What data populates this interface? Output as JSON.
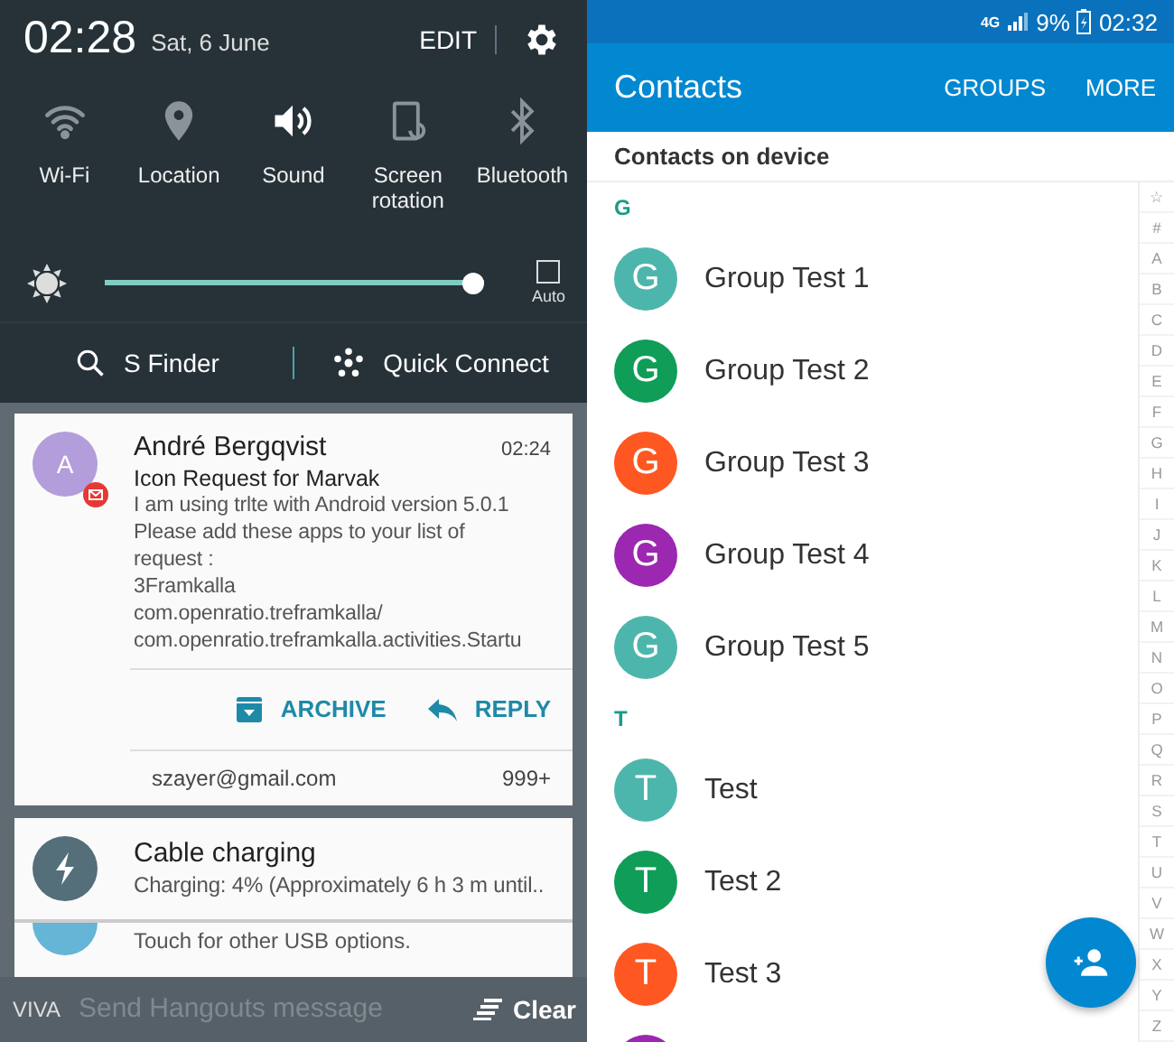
{
  "quick_panel": {
    "time": "02:28",
    "date": "Sat, 6 June",
    "edit": "EDIT",
    "toggles": [
      {
        "kind": "wifi",
        "label": "Wi-Fi",
        "on": false
      },
      {
        "kind": "location",
        "label": "Location",
        "on": false
      },
      {
        "kind": "sound",
        "label": "Sound",
        "on": true
      },
      {
        "kind": "rotation",
        "label": "Screen rotation",
        "on": false
      },
      {
        "kind": "bluetooth",
        "label": "Bluetooth",
        "on": false
      }
    ],
    "brightness": {
      "level": 1,
      "auto_label": "Auto",
      "auto_checked": false
    },
    "shortcuts": [
      {
        "kind": "search",
        "label": "S Finder"
      },
      {
        "kind": "connect",
        "label": "Quick Connect"
      }
    ]
  },
  "notifications": [
    {
      "kind": "email",
      "avatar": "A",
      "sender": "André Bergqvist",
      "time": "02:24",
      "subject": "Icon Request for Marvak",
      "body": [
        "I am using trlte with Android version 5.0.1",
        "Please add these apps to your list of",
        "request :",
        "3Framkalla",
        "com.openratio.treframkalla/",
        "com.openratio.treframkalla.activities.Startu"
      ],
      "actions": [
        {
          "kind": "archive",
          "label": "ARCHIVE"
        },
        {
          "kind": "reply",
          "label": "REPLY"
        }
      ],
      "account": "szayer@gmail.com",
      "count": "999+"
    },
    {
      "kind": "charging",
      "title": "Cable charging",
      "text": "Charging: 4% (Approximately 6 h 3 m until.."
    },
    {
      "kind": "usb",
      "text": "Touch for other USB options."
    }
  ],
  "background_app": {
    "label": "VIVA",
    "placeholder": "Send Hangouts message"
  },
  "clear_button": "Clear",
  "contacts_app": {
    "status_bar": {
      "network": "4G",
      "battery": "9%",
      "time": "02:32"
    },
    "title": "Contacts",
    "actions": [
      "GROUPS",
      "MORE"
    ],
    "subheader": "Contacts on device",
    "sections": [
      {
        "letter": "G",
        "contacts": [
          {
            "initial": "G",
            "name": "Group Test 1",
            "color": "#4db6ac"
          },
          {
            "initial": "G",
            "name": "Group Test 2",
            "color": "#0f9d58"
          },
          {
            "initial": "G",
            "name": "Group Test 3",
            "color": "#ff5722"
          },
          {
            "initial": "G",
            "name": "Group Test 4",
            "color": "#9c27b0"
          },
          {
            "initial": "G",
            "name": "Group Test 5",
            "color": "#4db6ac"
          }
        ]
      },
      {
        "letter": "T",
        "contacts": [
          {
            "initial": "T",
            "name": "Test",
            "color": "#4db6ac"
          },
          {
            "initial": "T",
            "name": "Test 2",
            "color": "#0f9d58"
          },
          {
            "initial": "T",
            "name": "Test 3",
            "color": "#ff5722"
          },
          {
            "color": "#9c27b0"
          }
        ]
      }
    ],
    "index": [
      "☆",
      "#",
      "A",
      "B",
      "C",
      "D",
      "E",
      "F",
      "G",
      "H",
      "I",
      "J",
      "K",
      "L",
      "M",
      "N",
      "O",
      "P",
      "Q",
      "R",
      "S",
      "T",
      "U",
      "V",
      "W",
      "X",
      "Y",
      "Z"
    ]
  }
}
